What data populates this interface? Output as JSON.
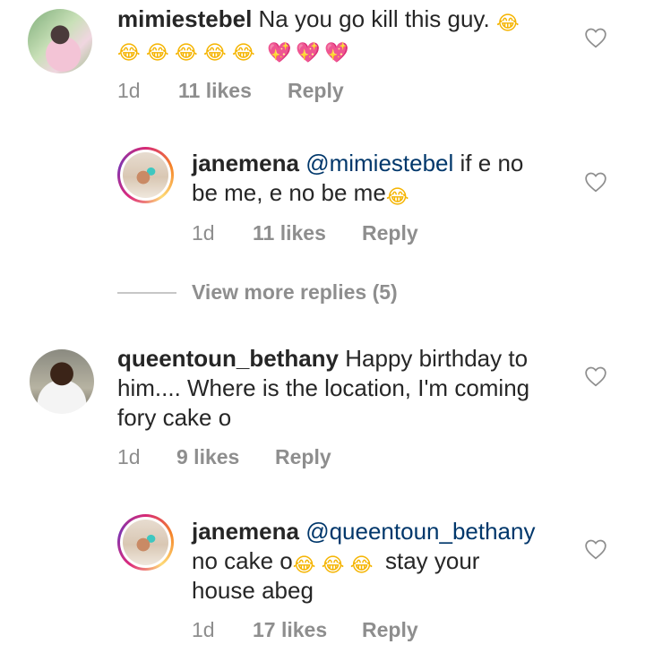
{
  "comments": [
    {
      "username": "mimiestebel",
      "text": "Na you go kill this guy.",
      "emoji_trailing": "😂",
      "emoji_line": [
        "😂",
        "😂",
        "😂",
        "😂",
        "😂",
        "💖",
        "💖",
        "💖"
      ],
      "time": "1d",
      "likes": "11 likes",
      "reply": "Reply"
    },
    {
      "username": "janemena",
      "mention": "@mimiestebel",
      "text_line1": "if e no",
      "text_line2": "be me, e no be me",
      "emoji_trailing": "😂",
      "time": "1d",
      "likes": "11 likes",
      "reply": "Reply"
    },
    {
      "username": "queentoun_bethany",
      "text_line1": "Happy birthday to",
      "text_line2": "him.... Where is the location, I'm coming",
      "text_line3": "fory cake o",
      "time": "1d",
      "likes": "9 likes",
      "reply": "Reply"
    },
    {
      "username": "janemena",
      "mention": "@queentoun_bethany",
      "text_line2_start": "no cake o",
      "emojis": [
        "😂",
        "😂",
        "😂"
      ],
      "text_line2_end": "stay your",
      "text_line3": "house abeg",
      "time": "1d",
      "likes": "17 likes",
      "reply": "Reply"
    }
  ],
  "view_more": "View more replies (5)",
  "colors": {
    "text": "#262626",
    "meta": "#8e8e8e",
    "mention": "#00376b",
    "divider": "#c7c7c7"
  },
  "icons": {
    "like": "heart-outline-icon",
    "laugh": "tears-of-joy-emoji",
    "heart": "sparkling-heart-emoji"
  }
}
